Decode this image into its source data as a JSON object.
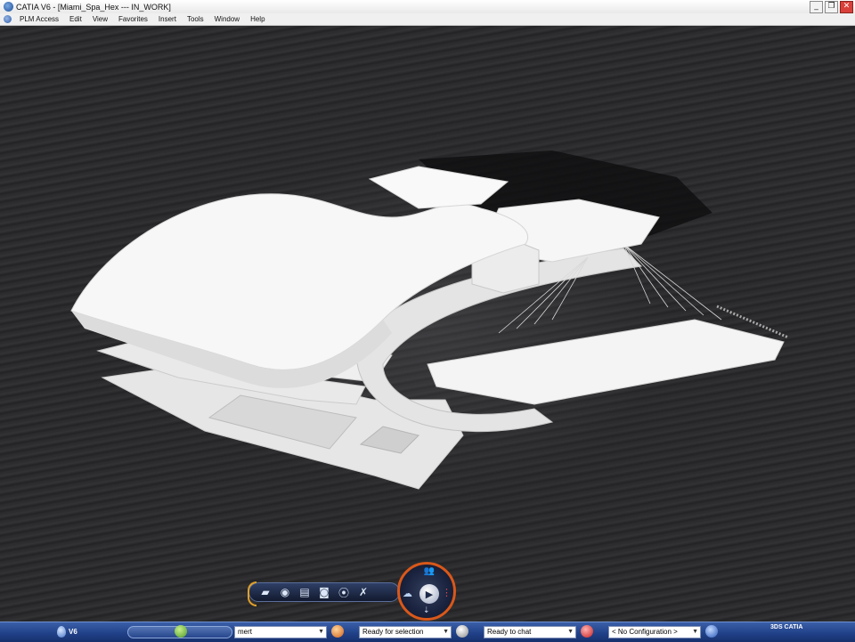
{
  "window": {
    "title": "CATIA V6 - [Miami_Spa_Hex --- IN_WORK]",
    "minimize_glyph": "_",
    "restore_glyph": "❐",
    "close_glyph": "✕"
  },
  "menu": {
    "items": [
      "PLM Access",
      "Edit",
      "View",
      "Favorites",
      "Insert",
      "Tools",
      "Window",
      "Help"
    ]
  },
  "viewport": {
    "content": "3D rendering of white spa building with wave-like roof over dark water",
    "colors": {
      "water": "#262628",
      "building": "#f2f2f2",
      "shadow": "#0c0c0c"
    }
  },
  "actionbar": {
    "tools": [
      {
        "name": "dashboard-icon",
        "glyph": "▰"
      },
      {
        "name": "sphere-icon",
        "glyph": "◉"
      },
      {
        "name": "render-icon",
        "glyph": "▤"
      },
      {
        "name": "camera-icon",
        "glyph": "◙"
      },
      {
        "name": "capture-icon",
        "glyph": "⦿"
      },
      {
        "name": "tools-icon",
        "glyph": "✗"
      }
    ]
  },
  "compass": {
    "play_glyph": "▶",
    "people_glyph": "👥",
    "cloud_glyph": "☁",
    "tree_glyph": "⋮",
    "arrows_glyph": "⇣"
  },
  "statusbar": {
    "brand": "V6",
    "search_value": "mert",
    "selection_status": "Ready for selection",
    "chat_status": "Ready to chat",
    "configuration": "< No Configuration >",
    "logo_text": "3DS CATIA"
  }
}
